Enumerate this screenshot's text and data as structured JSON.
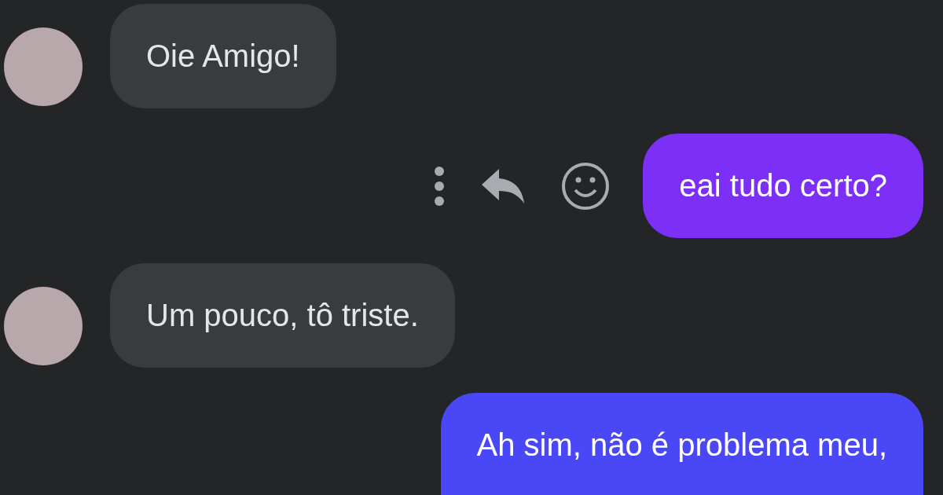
{
  "messages": [
    {
      "kind": "incoming",
      "text": "Oie Amigo!",
      "show_actions": false
    },
    {
      "kind": "outgoing",
      "text": "eai tudo certo?",
      "color": "#7b2ff7",
      "show_actions": true
    },
    {
      "kind": "incoming",
      "text": "Um pouco, tô triste.",
      "show_actions": false
    },
    {
      "kind": "outgoing",
      "text": "Ah sim, não é problema meu,",
      "color": "#4a47f6",
      "show_actions": false
    }
  ]
}
